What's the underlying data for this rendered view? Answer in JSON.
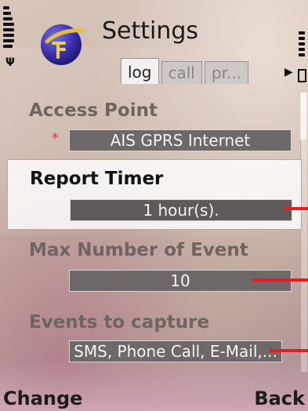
{
  "header": {
    "title": "Settings",
    "tabs": [
      {
        "label": "log",
        "active": true
      },
      {
        "label": "call",
        "active": false
      },
      {
        "label": "pr...",
        "active": false
      }
    ]
  },
  "status": {
    "signal_icon": "signal-bars-icon",
    "battery_icon": "battery-bars-icon"
  },
  "settings": [
    {
      "label": "Access Point",
      "value": "AIS GPRS Internet",
      "required": true
    },
    {
      "label": "Report Timer",
      "value": "1 hour(s).",
      "selected": true
    },
    {
      "label": "Max Number of Event",
      "value": "10"
    },
    {
      "label": "Events to capture",
      "value": "SMS, Phone Call, E-Mail,..."
    }
  ],
  "required_marker": "*",
  "softkeys": {
    "left": "Change",
    "right": "Back"
  },
  "colors": {
    "highlight_bg": "#ffffff",
    "field_bg": "#6f6868",
    "annotation_red": "#e01f25",
    "required_red": "#d8394a"
  }
}
